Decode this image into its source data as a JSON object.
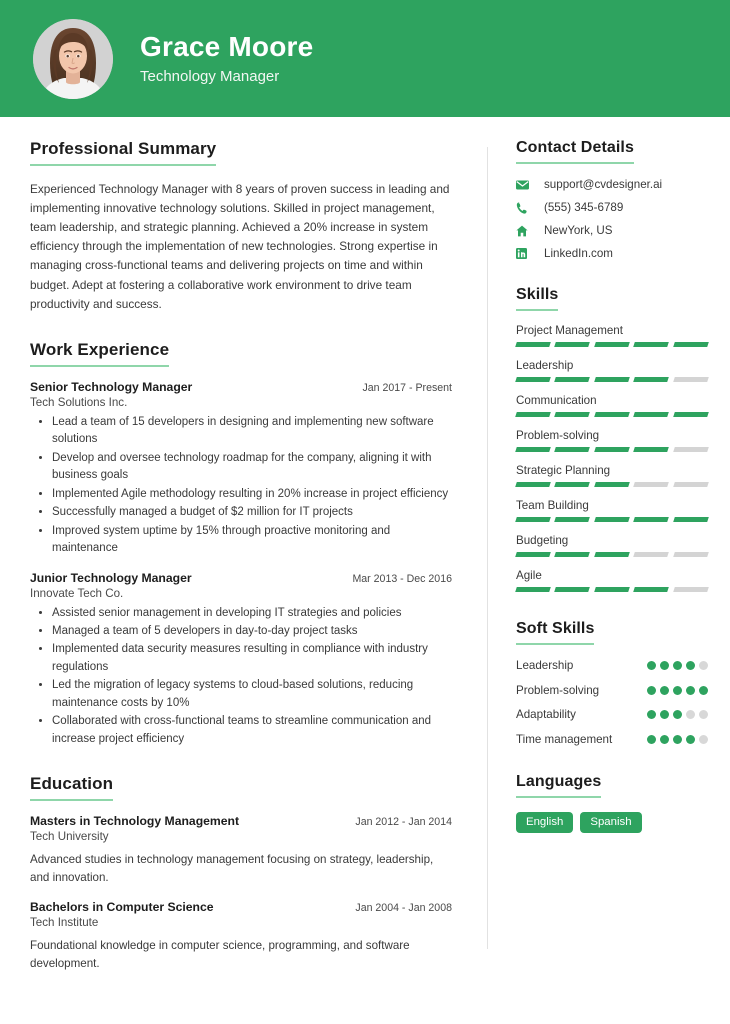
{
  "theme": {
    "accent": "#2ea35f",
    "accent_light": "#8fd6aa",
    "text": "#3a3a3a",
    "muted": "#d4d4d4"
  },
  "header": {
    "name": "Grace Moore",
    "role": "Technology Manager",
    "avatar_alt": "portrait-photo"
  },
  "summary": {
    "heading": "Professional Summary",
    "text": "Experienced Technology Manager with 8 years of proven success in leading and implementing innovative technology solutions. Skilled in project management, team leadership, and strategic planning. Achieved a 20% increase in system efficiency through the implementation of new technologies. Strong expertise in managing cross-functional teams and delivering projects on time and within budget. Adept at fostering a collaborative work environment to drive team productivity and success."
  },
  "experience": {
    "heading": "Work Experience",
    "entries": [
      {
        "title": "Senior Technology Manager",
        "date": "Jan 2017 - Present",
        "org": "Tech Solutions Inc.",
        "bullets": [
          "Lead a team of 15 developers in designing and implementing new software solutions",
          "Develop and oversee technology roadmap for the company, aligning it with business goals",
          "Implemented Agile methodology resulting in 20% increase in project efficiency",
          "Successfully managed a budget of $2 million for IT projects",
          "Improved system uptime by 15% through proactive monitoring and maintenance"
        ]
      },
      {
        "title": "Junior Technology Manager",
        "date": "Mar 2013 - Dec 2016",
        "org": "Innovate Tech Co.",
        "bullets": [
          "Assisted senior management in developing IT strategies and policies",
          "Managed a team of 5 developers in day-to-day project tasks",
          "Implemented data security measures resulting in compliance with industry regulations",
          "Led the migration of legacy systems to cloud-based solutions, reducing maintenance costs by 10%",
          "Collaborated with cross-functional teams to streamline communication and increase project efficiency"
        ]
      }
    ]
  },
  "education": {
    "heading": "Education",
    "entries": [
      {
        "title": "Masters in Technology Management",
        "date": "Jan 2012 - Jan 2014",
        "org": "Tech University",
        "desc": "Advanced studies in technology management focusing on strategy, leadership, and innovation."
      },
      {
        "title": "Bachelors in Computer Science",
        "date": "Jan 2004 - Jan 2008",
        "org": "Tech Institute",
        "desc": "Foundational knowledge in computer science, programming, and software development."
      }
    ]
  },
  "contact": {
    "heading": "Contact Details",
    "items": [
      {
        "icon": "envelope-icon",
        "value": "support@cvdesigner.ai"
      },
      {
        "icon": "phone-icon",
        "value": "(555) 345-6789"
      },
      {
        "icon": "home-icon",
        "value": "NewYork, US"
      },
      {
        "icon": "linkedin-icon",
        "value": "LinkedIn.com"
      }
    ]
  },
  "skills": {
    "heading": "Skills",
    "max": 5,
    "items": [
      {
        "label": "Project Management",
        "level": 5
      },
      {
        "label": "Leadership",
        "level": 4
      },
      {
        "label": "Communication",
        "level": 5
      },
      {
        "label": "Problem-solving",
        "level": 4
      },
      {
        "label": "Strategic Planning",
        "level": 3
      },
      {
        "label": "Team Building",
        "level": 5
      },
      {
        "label": "Budgeting",
        "level": 3
      },
      {
        "label": "Agile",
        "level": 4
      }
    ]
  },
  "soft_skills": {
    "heading": "Soft Skills",
    "max": 5,
    "items": [
      {
        "label": "Leadership",
        "level": 4
      },
      {
        "label": "Problem-solving",
        "level": 5
      },
      {
        "label": "Adaptability",
        "level": 3
      },
      {
        "label": "Time management",
        "level": 4
      }
    ]
  },
  "languages": {
    "heading": "Languages",
    "items": [
      "English",
      "Spanish"
    ]
  }
}
